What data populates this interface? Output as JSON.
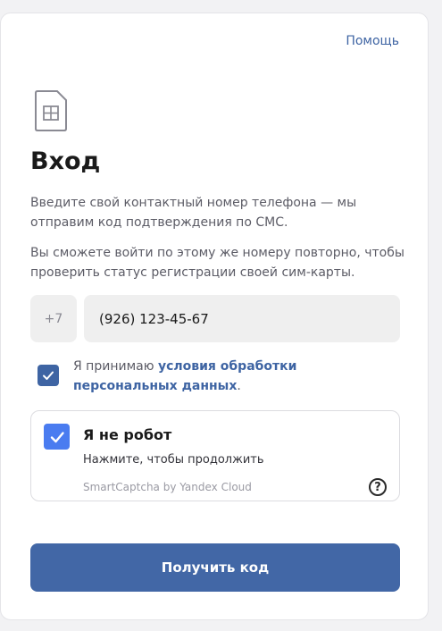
{
  "header": {
    "help_label": "Помощь"
  },
  "icons": {
    "sim": "sim-card-icon",
    "check": "checkmark-icon",
    "help": "question-circle-icon"
  },
  "login": {
    "title": "Вход",
    "description_1": "Введите свой контактный номер телефона — мы отправим код подтверждения по СМС.",
    "description_2": "Вы сможете войти по этому же номеру повторно, чтобы проверить статус регистрации своей сим-карты."
  },
  "phone": {
    "prefix": "+7",
    "value": "(926) 123-45-67"
  },
  "consent": {
    "checked": true,
    "text_before": "Я принимаю ",
    "link_text": "условия обработки персональных данных",
    "text_after": "."
  },
  "captcha": {
    "checked": true,
    "title": "Я не робот",
    "subtitle": "Нажмите, чтобы продолжить",
    "brand": "SmartCaptcha by Yandex Cloud",
    "help_symbol": "?"
  },
  "actions": {
    "submit_label": "Получить код"
  },
  "colors": {
    "accent": "#3e64a3",
    "button": "#4267a6",
    "captcha_check": "#4a7cf0",
    "input_bg": "#efefef"
  }
}
